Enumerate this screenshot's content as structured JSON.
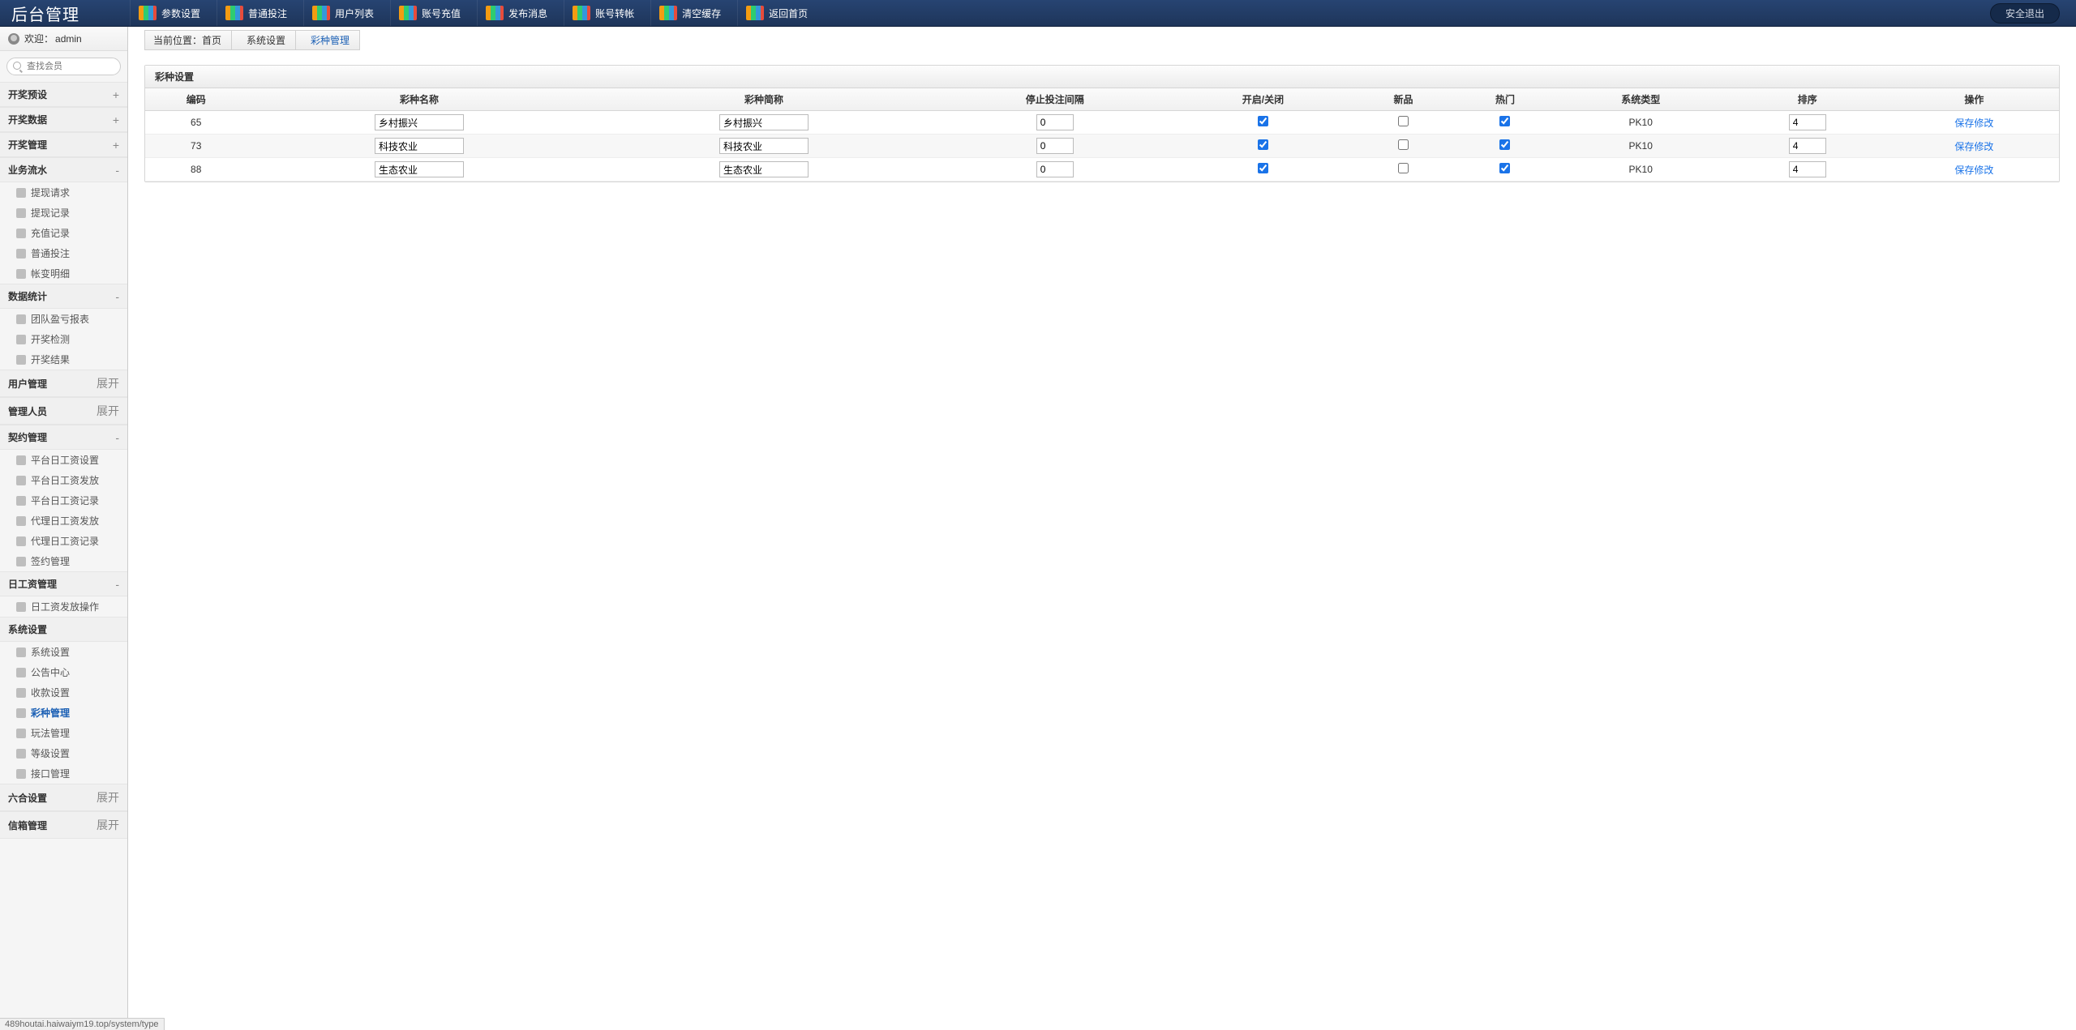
{
  "app_title": "后台管理",
  "topnav": [
    {
      "label": "参数设置"
    },
    {
      "label": "普通投注"
    },
    {
      "label": "用户列表"
    },
    {
      "label": "账号充值"
    },
    {
      "label": "发布消息"
    },
    {
      "label": "账号转帐"
    },
    {
      "label": "清空缓存"
    },
    {
      "label": "返回首页"
    }
  ],
  "logout_label": "安全退出",
  "welcome_prefix": "欢迎：",
  "welcome_user": "admin",
  "search_placeholder": "查找会员",
  "sidebar": [
    {
      "type": "head",
      "label": "开奖预设",
      "toggle": "+"
    },
    {
      "type": "head",
      "label": "开奖数据",
      "toggle": "+"
    },
    {
      "type": "head",
      "label": "开奖管理",
      "toggle": "+"
    },
    {
      "type": "head",
      "label": "业务流水",
      "toggle": "-"
    },
    {
      "type": "item",
      "label": "提现请求"
    },
    {
      "type": "item",
      "label": "提现记录"
    },
    {
      "type": "item",
      "label": "充值记录"
    },
    {
      "type": "item",
      "label": "普通投注"
    },
    {
      "type": "item",
      "label": "帐变明细"
    },
    {
      "type": "head",
      "label": "数据统计",
      "toggle": "-"
    },
    {
      "type": "item",
      "label": "团队盈亏报表"
    },
    {
      "type": "item",
      "label": "开奖检测"
    },
    {
      "type": "item",
      "label": "开奖结果"
    },
    {
      "type": "head",
      "label": "用户管理",
      "toggle": "展开"
    },
    {
      "type": "head",
      "label": "管理人员",
      "toggle": "展开"
    },
    {
      "type": "head",
      "label": "契约管理",
      "toggle": "-"
    },
    {
      "type": "item",
      "label": "平台日工资设置"
    },
    {
      "type": "item",
      "label": "平台日工资发放"
    },
    {
      "type": "item",
      "label": "平台日工资记录"
    },
    {
      "type": "item",
      "label": "代理日工资发放"
    },
    {
      "type": "item",
      "label": "代理日工资记录"
    },
    {
      "type": "item",
      "label": "签约管理"
    },
    {
      "type": "head",
      "label": "日工资管理",
      "toggle": "-"
    },
    {
      "type": "item",
      "label": "日工资发放操作"
    },
    {
      "type": "head",
      "label": "系统设置",
      "toggle": ""
    },
    {
      "type": "item",
      "label": "系统设置"
    },
    {
      "type": "item",
      "label": "公告中心"
    },
    {
      "type": "item",
      "label": "收款设置"
    },
    {
      "type": "item",
      "label": "彩种管理",
      "active": true
    },
    {
      "type": "item",
      "label": "玩法管理"
    },
    {
      "type": "item",
      "label": "等级设置"
    },
    {
      "type": "item",
      "label": "接口管理"
    },
    {
      "type": "head",
      "label": "六合设置",
      "toggle": "展开"
    },
    {
      "type": "head",
      "label": "信箱管理",
      "toggle": "展开"
    }
  ],
  "breadcrumb": {
    "prefix": "当前位置：",
    "items": [
      "首页",
      "系统设置",
      "彩种管理"
    ]
  },
  "panel_title": "彩种设置",
  "columns": [
    "编码",
    "彩种名称",
    "彩种简称",
    "停止投注间隔",
    "开启/关闭",
    "新品",
    "热门",
    "系统类型",
    "排序",
    "操作"
  ],
  "rows": [
    {
      "code": "65",
      "name": "乡村振兴",
      "short": "乡村振兴",
      "interval": "0",
      "open": true,
      "new": false,
      "hot": true,
      "systype": "PK10",
      "sort": "4",
      "action": "保存修改"
    },
    {
      "code": "73",
      "name": "科技农业",
      "short": "科技农业",
      "interval": "0",
      "open": true,
      "new": false,
      "hot": true,
      "systype": "PK10",
      "sort": "4",
      "action": "保存修改"
    },
    {
      "code": "88",
      "name": "生态农业",
      "short": "生态农业",
      "interval": "0",
      "open": true,
      "new": false,
      "hot": true,
      "systype": "PK10",
      "sort": "4",
      "action": "保存修改"
    }
  ],
  "status_url": "489houtai.haiwaiym19.top/system/type"
}
